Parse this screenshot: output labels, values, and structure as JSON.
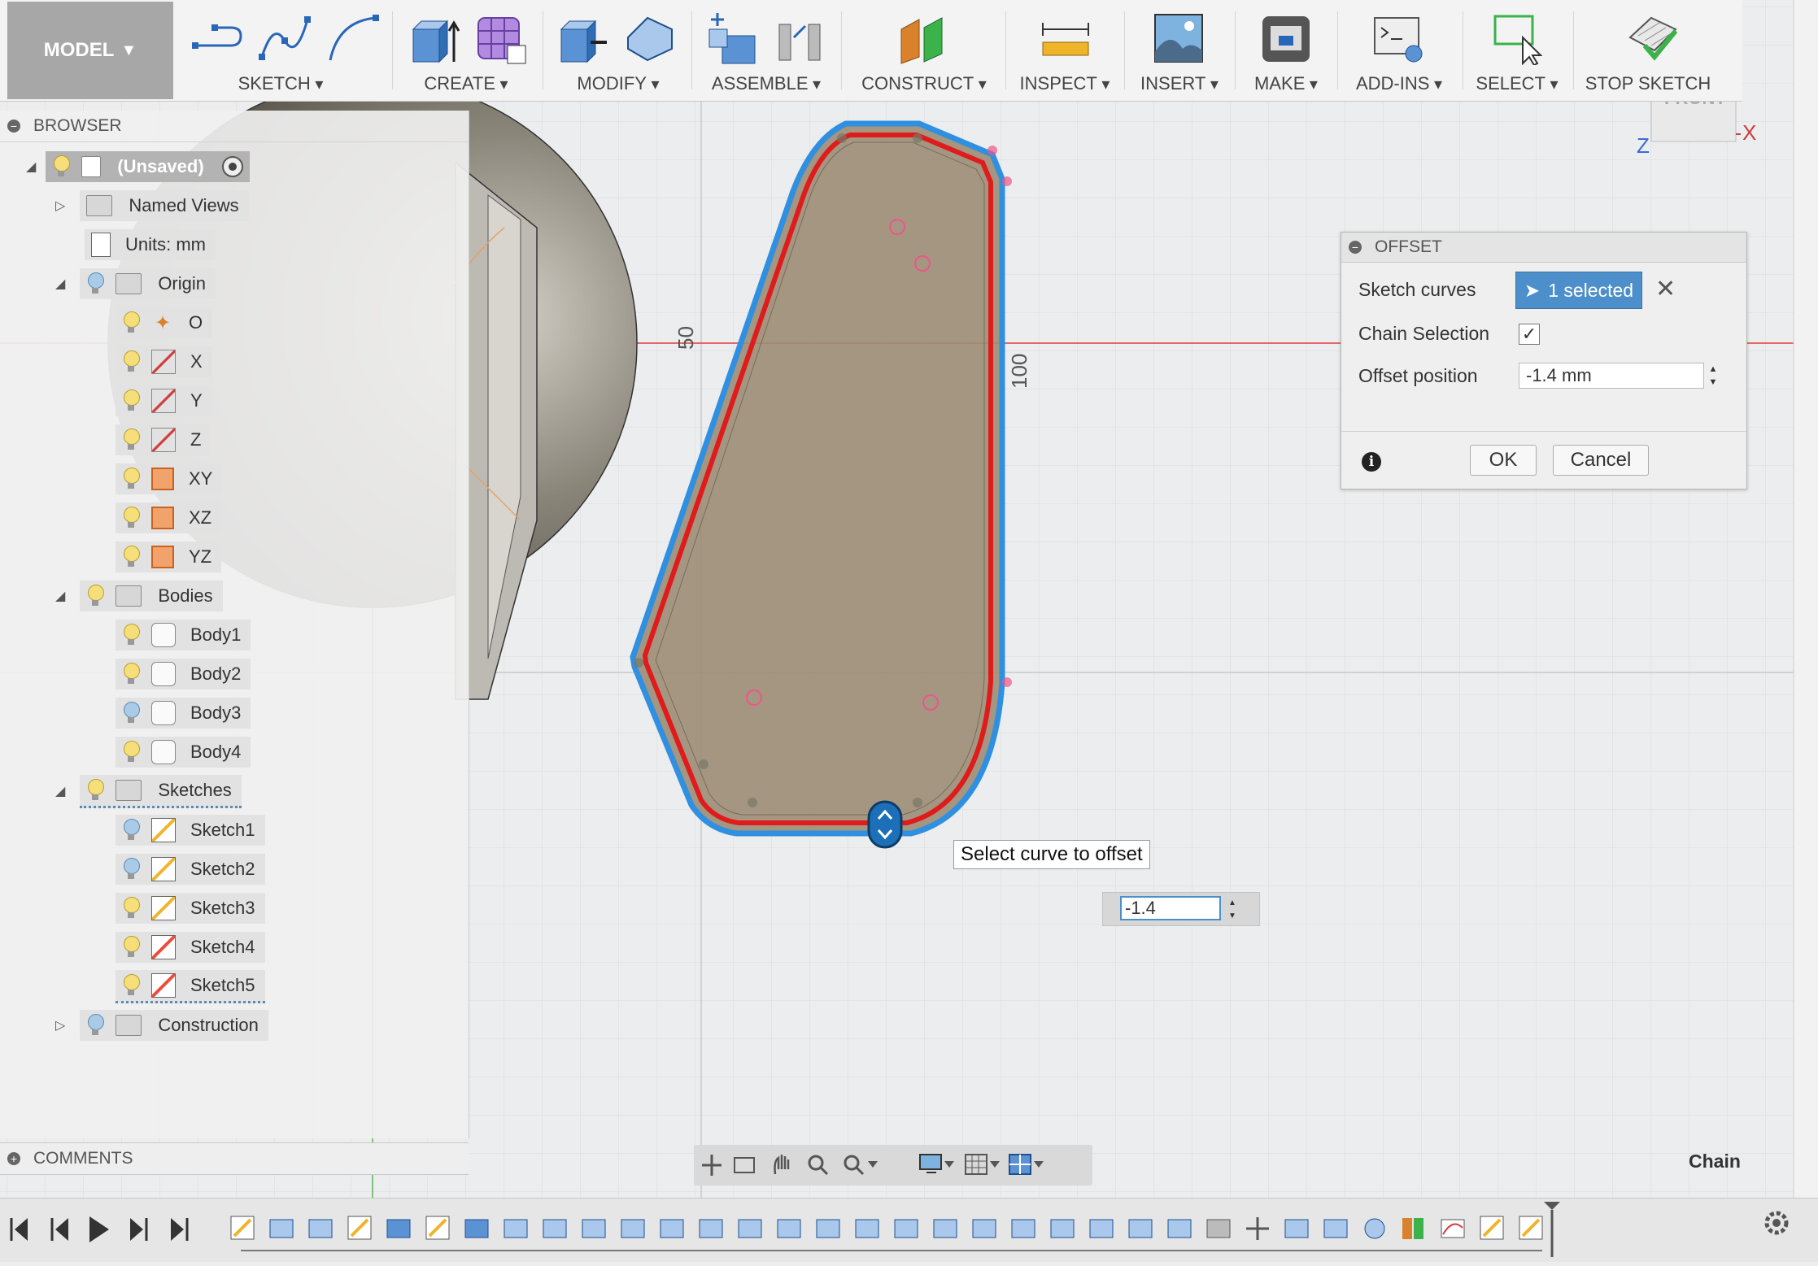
{
  "toolbar": {
    "workspace": "MODEL",
    "groups": [
      "SKETCH",
      "CREATE",
      "MODIFY",
      "ASSEMBLE",
      "CONSTRUCT",
      "INSPECT",
      "INSERT",
      "MAKE",
      "ADD-INS",
      "SELECT",
      "STOP SKETCH"
    ]
  },
  "browser": {
    "title": "BROWSER",
    "root": "(Unsaved)",
    "named_views": "Named Views",
    "units": "Units: mm",
    "origin": "Origin",
    "origin_items": [
      "O",
      "X",
      "Y",
      "Z",
      "XY",
      "XZ",
      "YZ"
    ],
    "bodies": "Bodies",
    "body_items": [
      "Body1",
      "Body2",
      "Body3",
      "Body4"
    ],
    "sketches": "Sketches",
    "sketch_items": [
      "Sketch1",
      "Sketch2",
      "Sketch3",
      "Sketch4",
      "Sketch5"
    ],
    "construction": "Construction"
  },
  "comments": {
    "title": "COMMENTS"
  },
  "offset_dialog": {
    "title": "OFFSET",
    "sketch_curves_label": "Sketch curves",
    "sketch_curves_value": "1 selected",
    "chain_selection_label": "Chain Selection",
    "chain_selection_checked": "✓",
    "offset_position_label": "Offset position",
    "offset_position_value": "-1.4 mm",
    "ok": "OK",
    "cancel": "Cancel"
  },
  "canvas": {
    "tooltip": "Select curve to offset",
    "input_value": "-1.4",
    "dim_50": "50",
    "dim_100": "100",
    "viewcube_label": "FRONT",
    "axis_x": "X",
    "axis_z": "Z"
  },
  "status": {
    "mode": "Chain"
  },
  "colors": {
    "accent": "#4d8fcb",
    "selection_blue": "#2f8fe0",
    "offset_red": "#e01b1b",
    "profile_fill": "#9c8c74"
  }
}
